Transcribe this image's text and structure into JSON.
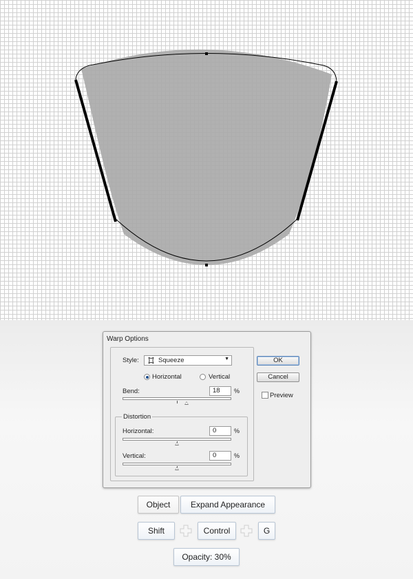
{
  "dialog": {
    "title": "Warp Options",
    "style_label": "Style:",
    "style_value": "Squeeze",
    "orientation": {
      "horizontal": "Horizontal",
      "vertical": "Vertical",
      "selected": "Horizontal"
    },
    "bend": {
      "label": "Bend:",
      "value": "18",
      "unit": "%"
    },
    "distortion": {
      "legend": "Distortion",
      "horizontal": {
        "label": "Horizontal:",
        "value": "0",
        "unit": "%"
      },
      "vertical": {
        "label": "Vertical:",
        "value": "0",
        "unit": "%"
      }
    },
    "ok_label": "OK",
    "cancel_label": "Cancel",
    "preview_label": "Preview",
    "preview_checked": false
  },
  "keys": {
    "row1": [
      "Object",
      "Expand Appearance"
    ],
    "row2": [
      "Shift",
      "Control",
      "G"
    ],
    "row3": [
      "Opacity: 30%"
    ]
  },
  "colors": {
    "shape_fill": "#a9a9a9",
    "path_stroke": "#000000",
    "grid_line": "#d0d0d0",
    "key_border": "#b8c5d4"
  },
  "icons": {
    "squeeze": "squeeze-style-icon",
    "plus": "plus-icon",
    "dropdown": "chevron-down-icon"
  }
}
